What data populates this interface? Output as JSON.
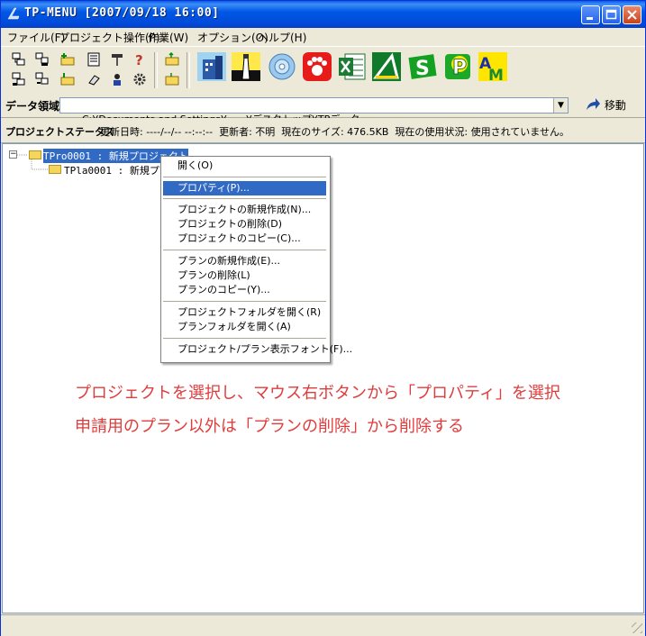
{
  "window": {
    "title": "TP-MENU [2007/09/18 16:00]"
  },
  "menubar": [
    "ファイル(F)",
    "プロジェクト操作(P)",
    "作業(W)",
    "オプション(O)",
    "ヘルプ(H)"
  ],
  "toolbar": {
    "small_icons": [
      "project-icon",
      "copy-icon",
      "folder-add-icon",
      "document-icon",
      "hammer-icon",
      "help-icon",
      "project-list-icon",
      "copy-list-icon",
      "folder-list-icon",
      "eraser-icon",
      "user-icon",
      "gear-icon",
      "open-folder-icon",
      "folder-icon"
    ],
    "big_icons": [
      "building-icon",
      "tower-icon",
      "disc-icon",
      "paw-icon",
      "excel-icon",
      "drafting-icon",
      "s-app-icon",
      "p-app-icon",
      "am-app-icon"
    ]
  },
  "data_area": {
    "label": "データ領域",
    "path": "C:¥Documents and Settings¥      ¥デスクトップ¥TPデータ",
    "move_label": "移動"
  },
  "status": {
    "label": "プロジェクトステータス",
    "text": "更新日時: ----/--/-- --:--:--  更新者: 不明  現在のサイズ: 476.5KB  現在の使用状況: 使用されていません。"
  },
  "tree": {
    "items": [
      {
        "label": "TPro0001 : 新規プロジェクト",
        "selected": true
      },
      {
        "label": "TPla0001 : 新規プラ",
        "selected": false
      }
    ]
  },
  "context_menu": {
    "items": [
      "開く(O)",
      "プロパティ(P)...",
      "プロジェクトの新規作成(N)...",
      "プロジェクトの削除(D)",
      "プロジェクトのコピー(C)...",
      "プランの新規作成(E)...",
      "プランの削除(L)",
      "プランのコピー(Y)...",
      "プロジェクトフォルダを開く(R)",
      "プランフォルダを開く(A)",
      "プロジェクト/プラン表示フォント(F)..."
    ],
    "highlighted": 1
  },
  "annotation": {
    "line1": "プロジェクトを選択し、マウス右ボタンから「プロパティ」を選択",
    "line2": "申請用のプラン以外は「プランの削除」から削除する"
  },
  "colors": {
    "title_blue": "#0058e6",
    "selection": "#316ac5",
    "annotation_red": "#e03c3c"
  }
}
